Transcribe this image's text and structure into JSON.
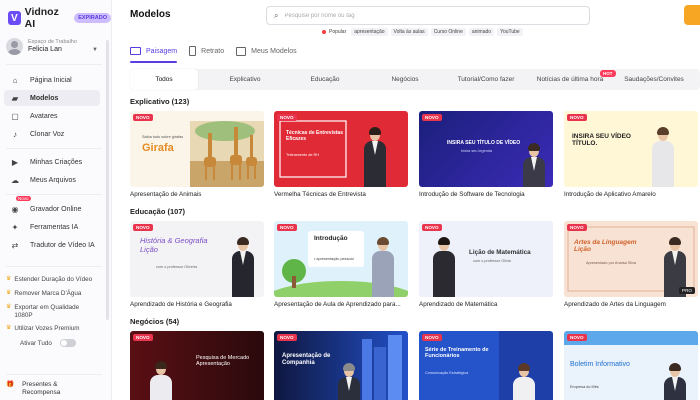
{
  "app": {
    "name": "Vidnoz AI",
    "badge": "EXPIRADO",
    "logo_letter": "V"
  },
  "workspace": {
    "label": "Espaço de Trabalho",
    "user": "Felicia Lan"
  },
  "nav": {
    "items": [
      {
        "label": "Página Inicial",
        "icon": "home-icon"
      },
      {
        "label": "Modelos",
        "icon": "folder-icon"
      },
      {
        "label": "Avatares",
        "icon": "avatar-icon"
      },
      {
        "label": "Clonar Voz",
        "icon": "voice-icon"
      },
      {
        "label": "Minhas Criações",
        "icon": "play-icon"
      },
      {
        "label": "Meus Arquivos",
        "icon": "cloud-icon"
      },
      {
        "label": "Gravador Online",
        "icon": "record-icon",
        "tag": "Novo"
      },
      {
        "label": "Ferramentas IA",
        "icon": "magic-icon"
      },
      {
        "label": "Tradutor de Vídeo IA",
        "icon": "translate-icon"
      }
    ]
  },
  "premium": {
    "items": [
      "Estender Duração do Vídeo",
      "Remover Marca D'Água",
      "Exportar em Qualidade 1080P",
      "Utilizar Vozes Premium"
    ],
    "toggle_label": "Ativar Tudo"
  },
  "gift": {
    "label": "Presentes & Recompensa"
  },
  "header": {
    "title": "Modelos",
    "search_placeholder": "Pesquise por nome ou tag",
    "popular_label": "Popular",
    "tags": [
      "apresentação",
      "Volta às aulas",
      "Curso Online",
      "animado",
      "YouTube"
    ]
  },
  "orientation": {
    "tabs": [
      "Paisagem",
      "Retrato",
      "Meus Modelos"
    ]
  },
  "categories": {
    "items": [
      "Todos",
      "Explicativo",
      "Educação",
      "Negócios",
      "Tutorial/Como fazer",
      "Notícias de última hora",
      "Saudações/Convites"
    ],
    "hot_label": "HOT"
  },
  "sections": [
    {
      "title": "Explicativo (123)",
      "cards": [
        {
          "caption": "Apresentação de Animais",
          "badge": "NOVO",
          "thumb_title": "Girafa",
          "thumb_sub": "Saiba tudo sobre girafas"
        },
        {
          "caption": "Vermelha Técnicas de Entrevista",
          "badge": "NOVO",
          "thumb_title": "Técnicas de Entrevistas Eficazes",
          "thumb_sub": "Treinamento de RH"
        },
        {
          "caption": "Introdução de Software de Tecnologia",
          "badge": "NOVO",
          "thumb_title": "INSIRA SEU TÍTULO DE VÍDEO",
          "thumb_sub": "Insira seu legenda"
        },
        {
          "caption": "Introdução de Aplicativo Amarelo",
          "badge": "NOVO",
          "thumb_title": "INSIRA SEU VÍDEO TÍTULO.",
          "thumb_sub": ""
        }
      ]
    },
    {
      "title": "Educação (107)",
      "cards": [
        {
          "caption": "Aprendizado de História e Geografia",
          "badge": "NOVO",
          "thumb_title": "História & Geografia Lição",
          "thumb_sub": "com o professor Oliveira"
        },
        {
          "caption": "Apresentação de Aula de Aprendizado para...",
          "badge": "NOVO",
          "thumb_title": "Introdução",
          "thumb_sub": "• apresentação pessoal"
        },
        {
          "caption": "Aprendizado de Matemática",
          "badge": "NOVO",
          "thumb_title": "Lição de Matemática",
          "thumb_sub": "com o professor Olivia"
        },
        {
          "caption": "Aprendizado de Artes da Linguagem",
          "badge": "NOVO",
          "thumb_title": "Artes da Linguagem Lição",
          "thumb_sub": "Apresentado por Anaísa Silva",
          "pro": "PRO"
        }
      ]
    },
    {
      "title": "Negócios (54)",
      "cards": [
        {
          "caption": "",
          "badge": "NOVO",
          "thumb_title": "Pesquisa de Mercado Apresentação",
          "thumb_sub": ""
        },
        {
          "caption": "",
          "badge": "NOVO",
          "thumb_title": "Apresentação de Companhia",
          "thumb_sub": ""
        },
        {
          "caption": "",
          "badge": "NOVO",
          "thumb_title": "Série de Treinamento de Funcionários",
          "thumb_sub": "Comunicação Estratégica"
        },
        {
          "caption": "",
          "badge": "NOVO",
          "thumb_title": "Boletim Informativo",
          "thumb_sub": "Empresa do Mês"
        }
      ]
    }
  ],
  "colors": {
    "accent": "#5a3ce0",
    "new_badge": "#e8344c",
    "brand": "#6b4cf6"
  }
}
